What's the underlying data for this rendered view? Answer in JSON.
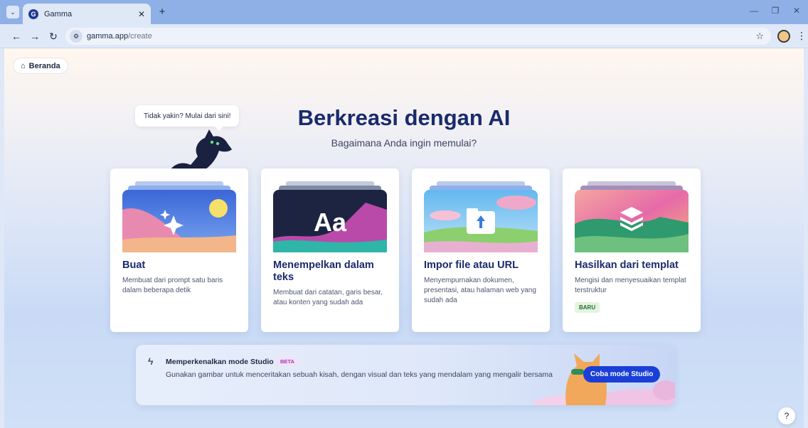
{
  "browser": {
    "tab_title": "Gamma",
    "tab_favicon_letter": "G",
    "url_host": "gamma.app",
    "url_path": "/create",
    "icons": [
      "tab-search-icon",
      "close-icon",
      "plus-icon",
      "minimize-icon",
      "restore-icon",
      "back-icon",
      "forward-icon",
      "reload-icon",
      "site-info-icon",
      "star-icon",
      "profile-icon",
      "kebab-menu-icon"
    ]
  },
  "page": {
    "home_label": "Beranda",
    "speech_bubble": "Tidak yakin? Mulai dari sini!",
    "title": "Berkreasi dengan AI",
    "subtitle": "Bagaimana Anda ingin memulai?",
    "cards": [
      {
        "title": "Buat",
        "desc": "Membuat dari prompt satu baris dalam beberapa detik"
      },
      {
        "title": "Menempelkan dalam teks",
        "art_text": "Aa",
        "desc": "Membuat dari catatan, garis besar, atau konten yang sudah ada"
      },
      {
        "title": "Impor file atau URL",
        "desc": "Menyempurnakan dokumen, presentasi, atau halaman web yang sudah ada"
      },
      {
        "title": "Hasilkan dari templat",
        "desc": "Mengisi dan menyesuaikan templat terstruktur",
        "badge": "BARU"
      }
    ],
    "promo": {
      "title": "Memperkenalkan mode Studio",
      "badge": "BETA",
      "text": "Gunakan gambar untuk menceritakan sebuah kisah, dengan visual dan teks yang mendalam yang mengalir bersama",
      "button": "Coba mode Studio"
    },
    "help": "?"
  },
  "colors": {
    "brand_navy": "#1a2a6c",
    "accent_blue": "#1a3fd6",
    "tab_bar": "#8fb0e6"
  }
}
